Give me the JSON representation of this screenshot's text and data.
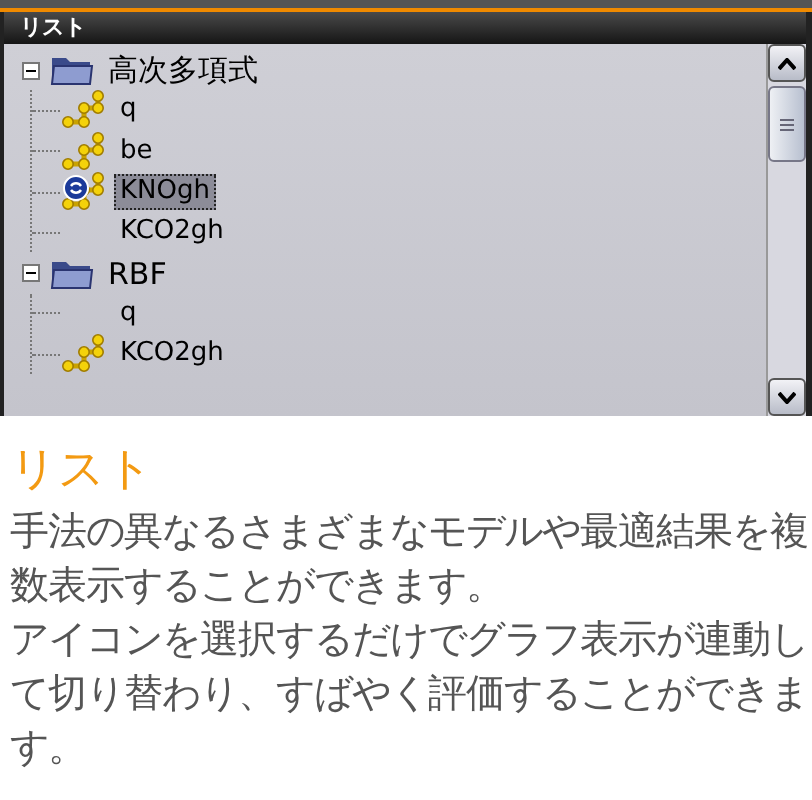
{
  "panel": {
    "title": "リスト",
    "tree": [
      {
        "label": "高次多項式",
        "expanded": true,
        "selected": false,
        "kind": "folder",
        "children": [
          {
            "label": "q",
            "kind": "graph",
            "selected": false
          },
          {
            "label": "be",
            "kind": "graph",
            "selected": false
          },
          {
            "label": "KNOgh",
            "kind": "linked-graph",
            "selected": true
          },
          {
            "label": "KCO2gh",
            "kind": "plain",
            "selected": false
          }
        ]
      },
      {
        "label": "RBF",
        "expanded": true,
        "selected": false,
        "kind": "folder",
        "children": [
          {
            "label": "q",
            "kind": "plain",
            "selected": false
          },
          {
            "label": "KCO2gh",
            "kind": "graph",
            "selected": false
          }
        ]
      }
    ]
  },
  "description": {
    "heading": "リスト",
    "paragraphs": [
      "手法の異なるさまざまなモデルや最適結果を複数表示することができます。",
      "アイコンを選択するだけでグラフ表示が連動して切り替わり、すばやく評価することができます。"
    ]
  }
}
